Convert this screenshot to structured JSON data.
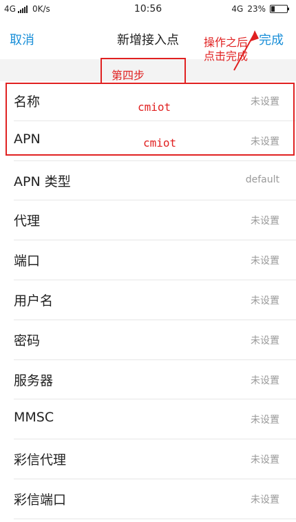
{
  "status_bar": {
    "network_left": "4G",
    "speed": "0K/s",
    "time": "10:56",
    "network_right": "4G",
    "battery": "23%",
    "battery_level": 0.23
  },
  "header": {
    "cancel_label": "取消",
    "title": "新增接入点",
    "done_label": "完成"
  },
  "rows": [
    {
      "label": "名称",
      "value": "未设置"
    },
    {
      "label": "APN",
      "value": "未设置"
    },
    {
      "label": "APN 类型",
      "value": "default"
    },
    {
      "label": "代理",
      "value": "未设置"
    },
    {
      "label": "端口",
      "value": "未设置"
    },
    {
      "label": "用户名",
      "value": "未设置"
    },
    {
      "label": "密码",
      "value": "未设置"
    },
    {
      "label": "服务器",
      "value": "未设置"
    },
    {
      "label": "MMSC",
      "value": "未设置"
    },
    {
      "label": "彩信代理",
      "value": "未设置"
    },
    {
      "label": "彩信端口",
      "value": "未设置"
    }
  ],
  "annotations": {
    "step": "第四步",
    "name_value": "cmiot",
    "apn_value": "cmiot",
    "note": "操作之后点击完成",
    "color": "#e02020"
  },
  "colors": {
    "accent": "#1a8fd8",
    "section_gap": "#f3f3f3"
  }
}
